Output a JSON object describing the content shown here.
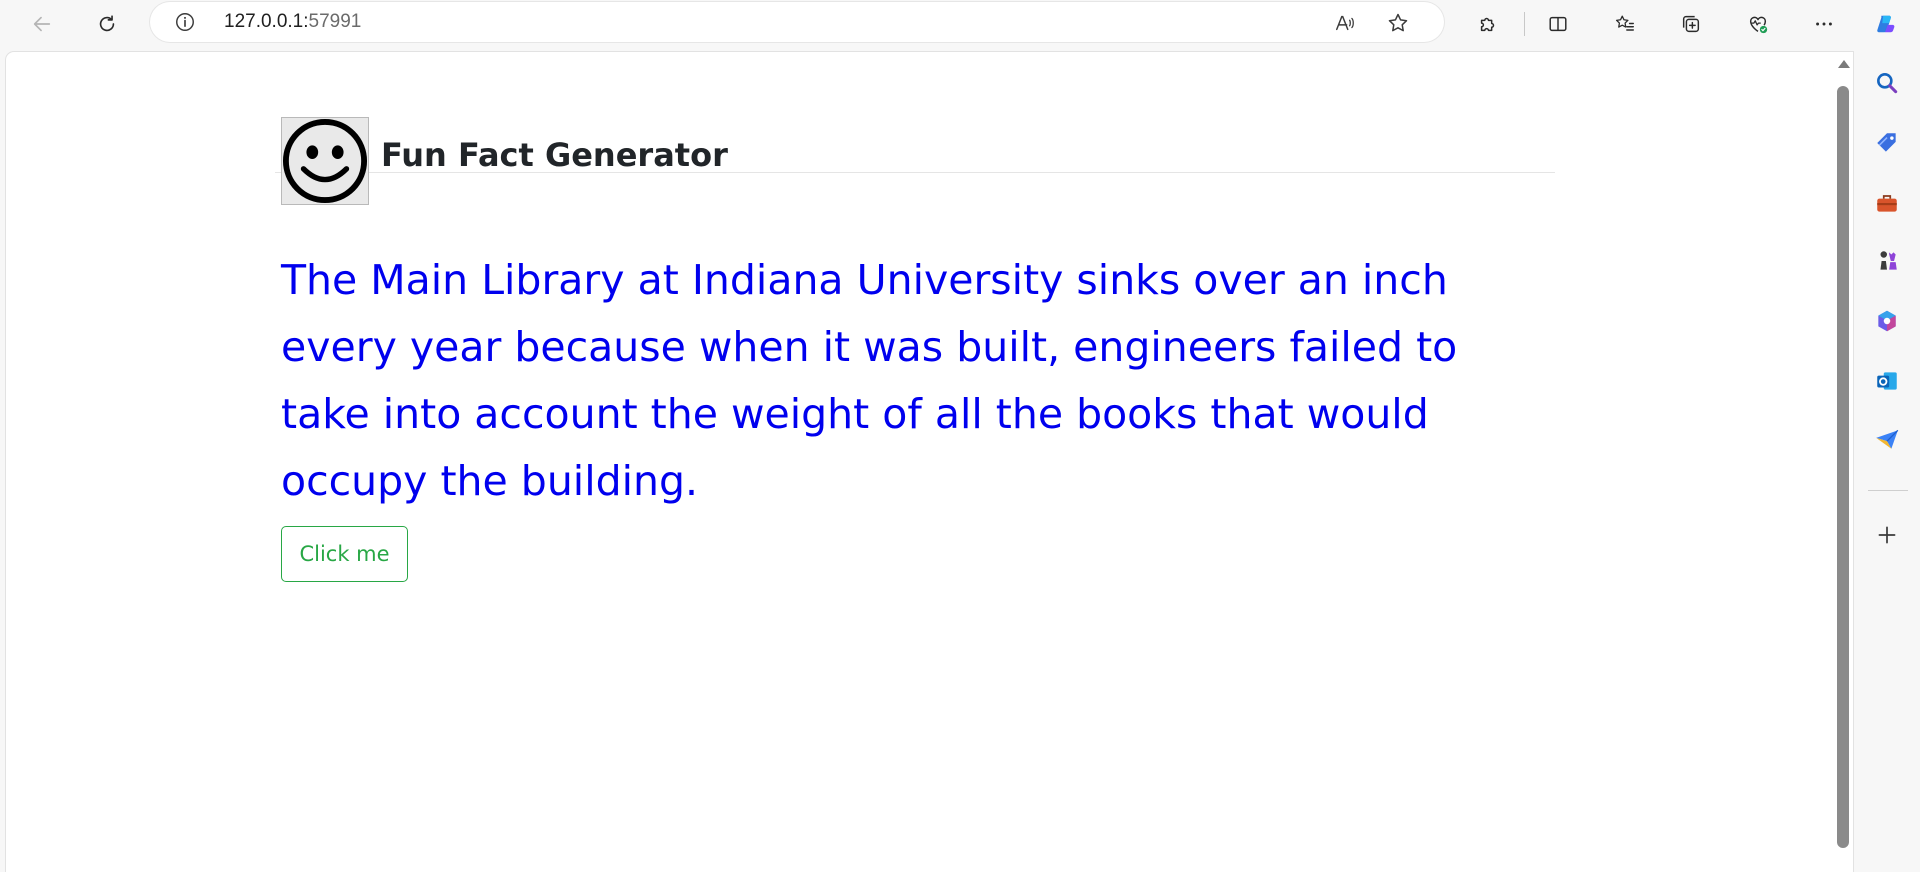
{
  "browser": {
    "url_host": "127.0.0.1:",
    "url_port": "57991",
    "icons": {
      "back": "back-arrow-icon",
      "refresh": "refresh-icon",
      "info": "info-icon",
      "read_aloud": "read-aloud-icon",
      "favorite": "star-icon",
      "extensions": "puzzle-icon",
      "split_screen": "split-screen-icon",
      "favorites": "favorites-list-icon",
      "collections": "collections-icon",
      "performance": "heart-pulse-icon",
      "more": "more-icon",
      "copilot": "copilot-icon"
    }
  },
  "sidebar": {
    "items": [
      "search-icon",
      "tag-icon",
      "toolbox-icon",
      "chess-icon",
      "microsoft365-icon",
      "outlook-icon",
      "send-icon",
      "add-icon"
    ]
  },
  "page": {
    "title": "Fun Fact Generator",
    "fact": "The Main Library at Indiana University sinks over an inch every year because when it was built, engineers failed to take into account the weight of all the books that would occupy the building.",
    "button_label": "Click me"
  },
  "colors": {
    "fact_text": "#0000ee",
    "button_accent": "#28a745",
    "title_text": "#212529"
  }
}
